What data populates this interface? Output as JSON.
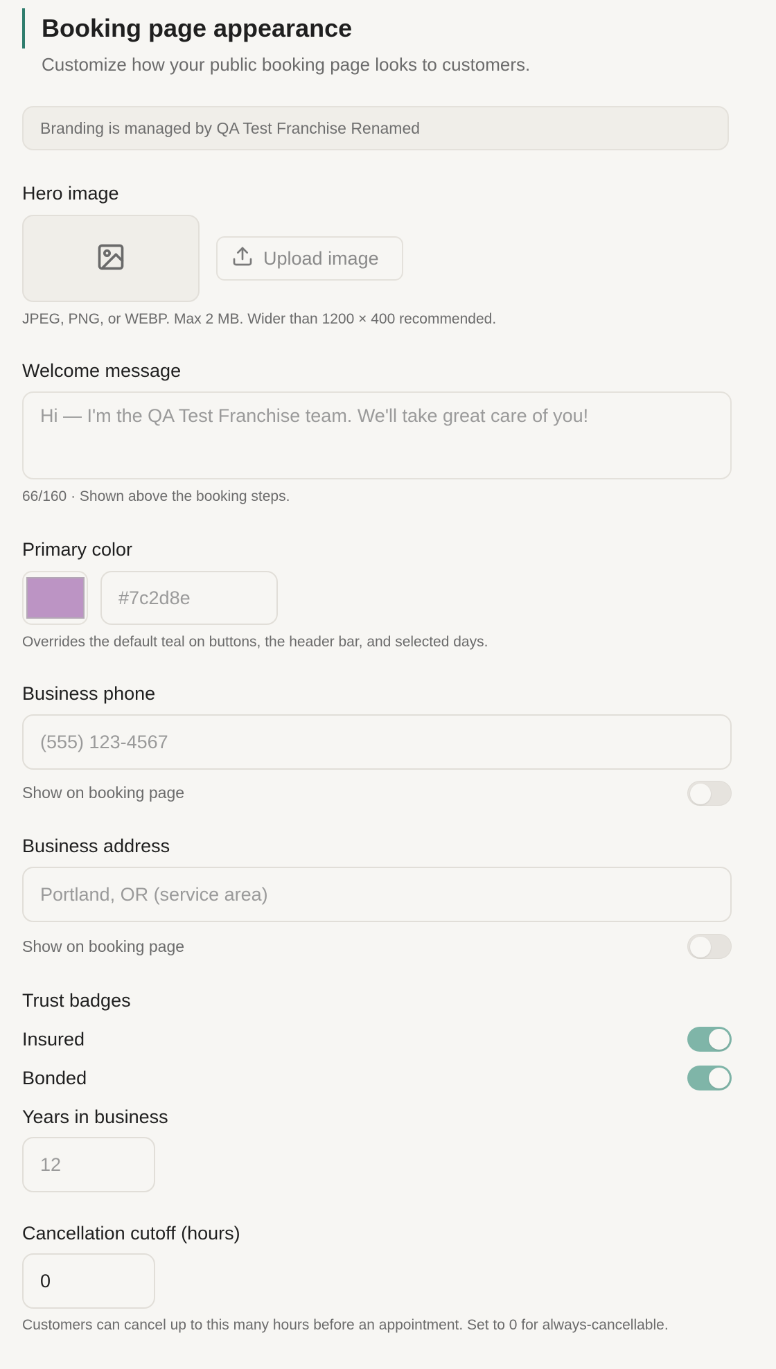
{
  "header": {
    "title": "Booking page appearance",
    "subtitle": "Customize how your public booking page looks to customers."
  },
  "notice": {
    "text": "Branding is managed by QA Test Franchise Renamed"
  },
  "hero": {
    "label": "Hero image",
    "upload_label": "Upload image",
    "help": "JPEG, PNG, or WEBP. Max 2 MB. Wider than 1200 × 400 recommended."
  },
  "welcome": {
    "label": "Welcome message",
    "placeholder": "Hi — I'm the QA Test Franchise team. We'll take great care of you!",
    "help": "66/160 · Shown above the booking steps."
  },
  "color": {
    "label": "Primary color",
    "value_placeholder": "#7c2d8e",
    "swatch": "#bc94c4",
    "help": "Overrides the default teal on buttons, the header bar, and selected days."
  },
  "phone": {
    "label": "Business phone",
    "placeholder": "(555) 123-4567",
    "toggle_label": "Show on booking page",
    "toggle_on": false
  },
  "address": {
    "label": "Business address",
    "placeholder": "Portland, OR (service area)",
    "toggle_label": "Show on booking page",
    "toggle_on": false
  },
  "badges": {
    "label": "Trust badges",
    "items": [
      {
        "label": "Insured",
        "on": true
      },
      {
        "label": "Bonded",
        "on": true
      }
    ],
    "years_label": "Years in business",
    "years_placeholder": "12"
  },
  "cancellation": {
    "label": "Cancellation cutoff (hours)",
    "value": "0",
    "help": "Customers can cancel up to this many hours before an appointment. Set to 0 for always-cancellable."
  },
  "colors": {
    "accent": "#2f7d6d",
    "toggle_on": "#7fb5a8",
    "toggle_off": "#e6e3de"
  }
}
